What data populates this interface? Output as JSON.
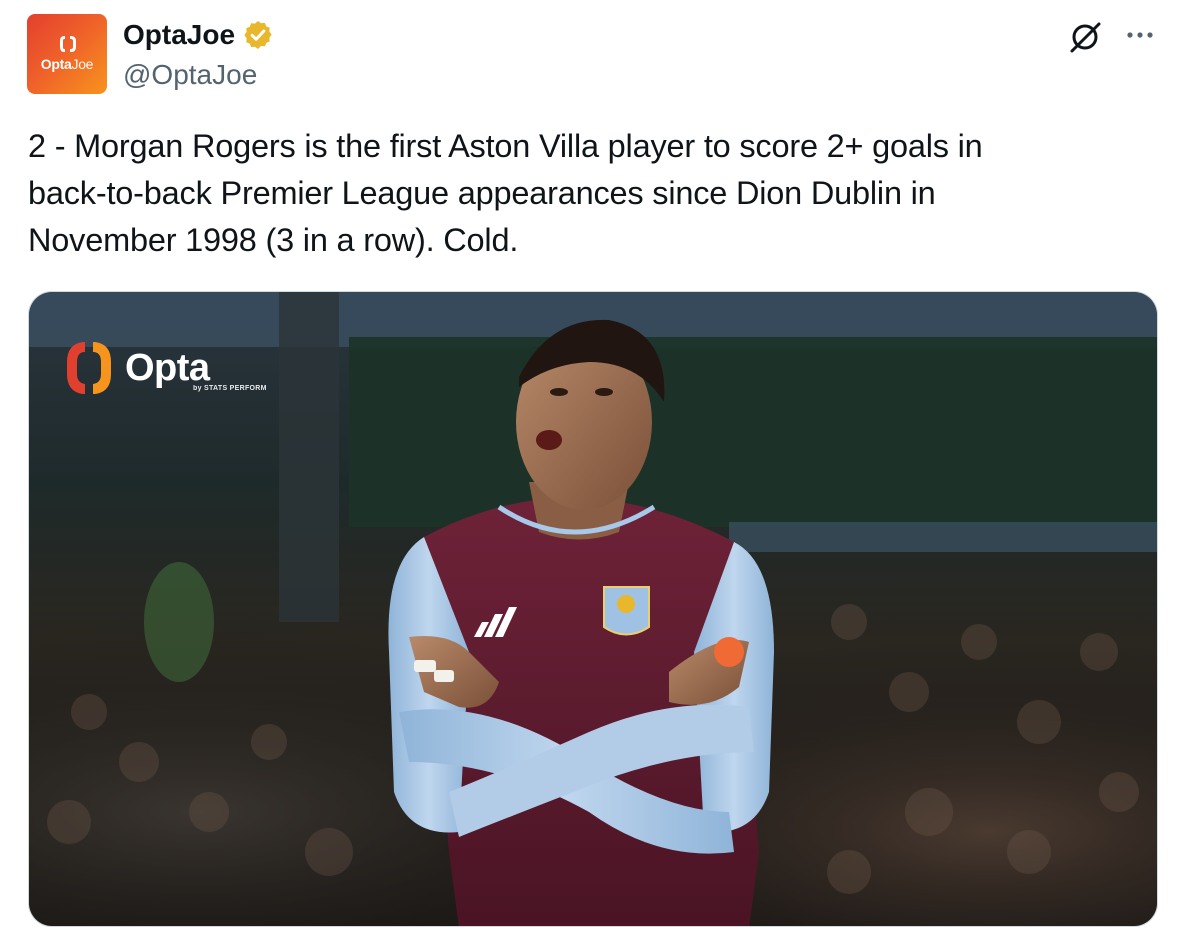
{
  "account": {
    "display_name": "OptaJoe",
    "handle": "@OptaJoe",
    "avatar_text_bold": "Opta",
    "avatar_text_light": "Joe",
    "verified": true,
    "verified_color": "#e8b72b"
  },
  "tweet": {
    "text": "2 - Morgan Rogers is the first Aston Villa player to score 2+ goals in\nback-to-back Premier League appearances since Dion Dublin in\nNovember 1998 (3 in a row). Cold."
  },
  "actions": {
    "grok_icon": "grok-icon",
    "more_icon": "more-dots-icon"
  },
  "media": {
    "watermark_word": "Opta",
    "watermark_sub": "by STATS PERFORM",
    "subject": "photo"
  },
  "colors": {
    "accent_orange": "#f7941d",
    "brand_red": "#e2402e",
    "claret": "#6b1f35",
    "sky_blue": "#a7c8e8",
    "text_primary": "#0f1419",
    "text_secondary": "#536471"
  }
}
